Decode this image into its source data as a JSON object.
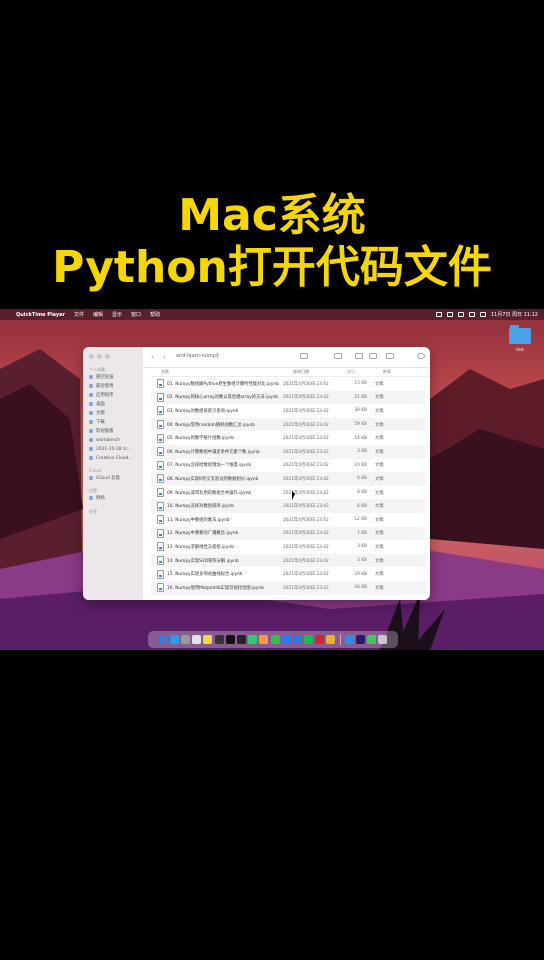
{
  "headline": {
    "line1": "Mac系统",
    "line2": "Python打开代码文件",
    "color": "#f5d60a"
  },
  "menubar": {
    "apple": "",
    "app_name": "QuickTime Player",
    "menus": [
      "文件",
      "编辑",
      "显示",
      "窗口",
      "帮助"
    ],
    "clock": "11月7日 周日 11:12"
  },
  "desktop": {
    "folder_label": "test"
  },
  "finder": {
    "path_title": "aml-learn-numpy",
    "sidebar": {
      "favorites_head": "个人收藏",
      "favorites": [
        "隔空投送",
        "最近使用",
        "应用程序",
        "桌面",
        "文稿",
        "下载",
        "影视观看",
        "workbench",
        "2021-10-18 tc...",
        "Creative Cloud..."
      ],
      "icloud_head": "iCloud",
      "icloud": [
        "iCloud 云盘"
      ],
      "location_head": "位置",
      "locations": [
        "网络"
      ],
      "tags_head": "标签"
    },
    "columns": {
      "name": "名称",
      "date": "修改日期",
      "size": "大小",
      "kind": "种类"
    },
    "files": [
      {
        "name": "01. Numpy数组跟Python原生数组计算时性能对比.ipynb",
        "date": "2021年4月30日 23:42",
        "size": "15 KB",
        "kind": "文稿"
      },
      {
        "name": "02. Numpy的核心array对象以及创建array的方法.ipynb",
        "date": "2021年4月30日 23:42",
        "size": "21 KB",
        "kind": "文稿"
      },
      {
        "name": "03. Numpy对数组按索引查询.ipynb",
        "date": "2021年4月30日 23:42",
        "size": "30 KB",
        "kind": "文稿"
      },
      {
        "name": "04. Numpy常用random随机函数汇总.ipynb",
        "date": "2021年4月30日 23:42",
        "size": "59 KB",
        "kind": "文稿"
      },
      {
        "name": "05. Numpy的数学统计函数.ipynb",
        "date": "2021年4月30日 23:42",
        "size": "14 KB",
        "kind": "文稿"
      },
      {
        "name": "06. Numpy计算数组中满足条件元素个数.ipynb",
        "date": "2021年4月30日 23:42",
        "size": "3 KB",
        "kind": "文稿"
      },
      {
        "name": "07. Numpy怎样给数组增加一个维度.ipynb",
        "date": "2021年4月30日 23:42",
        "size": "10 KB",
        "kind": "文稿"
      },
      {
        "name": "08. Numpy实现K折交叉验证的数据划分.ipynb",
        "date": "2021年4月30日 23:42",
        "size": "6 KB",
        "kind": "文稿"
      },
      {
        "name": "09. Numpy非常有用的数组合并操作.ipynb",
        "date": "2021年4月30日 23:42",
        "size": "8 KB",
        "kind": "文稿"
      },
      {
        "name": "10. Numpy怎样对数组排序.ipynb",
        "date": "2021年4月30日 23:42",
        "size": "6 KB",
        "kind": "文稿"
      },
      {
        "name": "11. Numpy中数组的乘法.ipynb",
        "date": "2021年4月30日 23:42",
        "size": "12 KB",
        "kind": "文稿"
      },
      {
        "name": "12. Numpy中重要的广播概念.ipynb",
        "date": "2021年4月30日 23:42",
        "size": "7 KB",
        "kind": "文稿"
      },
      {
        "name": "13. Numpy求解线性方程组.ipynb",
        "date": "2021年4月30日 23:42",
        "size": "3 KB",
        "kind": "文稿"
      },
      {
        "name": "14. Numpy实现SVD矩阵分解.ipynb",
        "date": "2021年4月30日 23:42",
        "size": "3 KB",
        "kind": "文稿"
      },
      {
        "name": "15. Numpy实现多项式曲线拟合.ipynb",
        "date": "2021年4月30日 23:42",
        "size": "29 KB",
        "kind": "文稿"
      },
      {
        "name": "16. Numpy使用Matplotlib实现可视化绘图.ipynb",
        "date": "2021年4月30日 23:42",
        "size": "34 KB",
        "kind": "文稿"
      }
    ]
  },
  "dock": {
    "apps": [
      "finder-app",
      "safari-app",
      "launchpad-app",
      "calendar-app",
      "notes-app",
      "quicktime-app",
      "capcut-app",
      "terminal-app",
      "pycharm-app",
      "sublime-app",
      "wechat-app",
      "dingtalk-app",
      "vscode-app",
      "spotify-app",
      "netease-app",
      "chrome-app",
      "appstore-app",
      "premiere-app",
      "messages-app",
      "trash-app"
    ]
  }
}
